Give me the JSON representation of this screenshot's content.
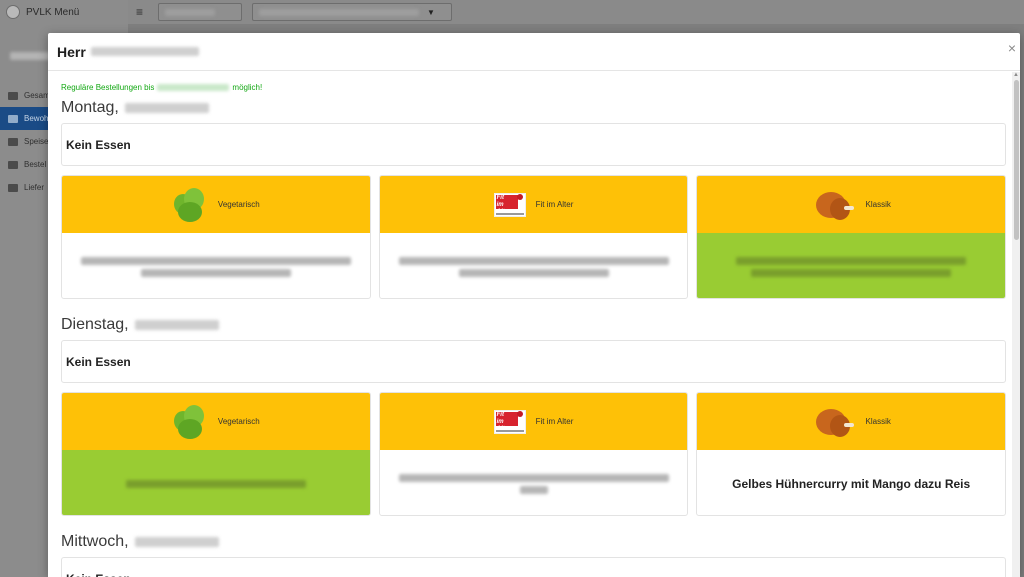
{
  "app": {
    "brand": "PVLK Menü",
    "nav": [
      {
        "label": "Gesamt",
        "active": false
      },
      {
        "label": "Bewoh",
        "active": true
      },
      {
        "label": "Speise",
        "active": false
      },
      {
        "label": "Bestel",
        "active": false
      },
      {
        "label": "Liefer",
        "active": false
      }
    ]
  },
  "modal": {
    "title": "Herr",
    "close": "×",
    "notice_prefix": "Reguläre Bestellungen bis",
    "notice_suffix": "möglich!"
  },
  "days": [
    {
      "name": "Montag,",
      "kein_essen": "Kein Essen",
      "cards": [
        {
          "category": "Vegetarisch",
          "icon": "salad-icon",
          "selected": false,
          "dish": ""
        },
        {
          "category": "Fit im Alter",
          "icon": "fit-im-alter-icon",
          "selected": false,
          "dish": ""
        },
        {
          "category": "Klassik",
          "icon": "chicken-icon",
          "selected": true,
          "dish": ""
        }
      ]
    },
    {
      "name": "Dienstag,",
      "kein_essen": "Kein Essen",
      "cards": [
        {
          "category": "Vegetarisch",
          "icon": "salad-icon",
          "selected": true,
          "dish": ""
        },
        {
          "category": "Fit im Alter",
          "icon": "fit-im-alter-icon",
          "selected": false,
          "dish": ""
        },
        {
          "category": "Klassik",
          "icon": "chicken-icon",
          "selected": false,
          "dish": "Gelbes Hühnercurry mit Mango dazu Reis"
        }
      ]
    },
    {
      "name": "Mittwoch,",
      "kein_essen": "Kein Essen",
      "cards": []
    }
  ],
  "colors": {
    "header_yellow": "#fec107",
    "selected_green": "#99cc33",
    "notice_green": "#13a813",
    "nav_active": "#1a4b86"
  }
}
